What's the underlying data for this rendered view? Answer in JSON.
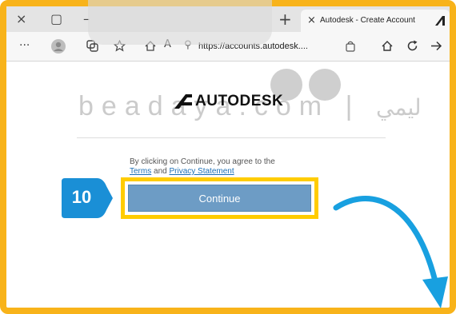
{
  "browser": {
    "window_controls": {
      "close": "×",
      "restore": "▢",
      "minimize": "–"
    },
    "new_tab_label": "+",
    "tab": {
      "close": "×",
      "title": "Autodesk - Create Account"
    },
    "address_bar": {
      "url": "https://accounts.autodesk...."
    }
  },
  "watermark": {
    "letters": "beadaya.com |",
    "arabic": "ليمي"
  },
  "page": {
    "brand": "AUTODESK",
    "terms_prefix": "By clicking on Continue, you agree to the",
    "terms_link": "Terms",
    "terms_and": "and",
    "privacy_link": "Privacy Statement",
    "continue_label": "Continue"
  },
  "annotation": {
    "step_number": "10"
  },
  "colors": {
    "frame": "#f8b31a",
    "highlight": "#ffcc00",
    "step_badge": "#1a8fd6",
    "arrow": "#18a0e0",
    "button": "#6d9cc5"
  }
}
